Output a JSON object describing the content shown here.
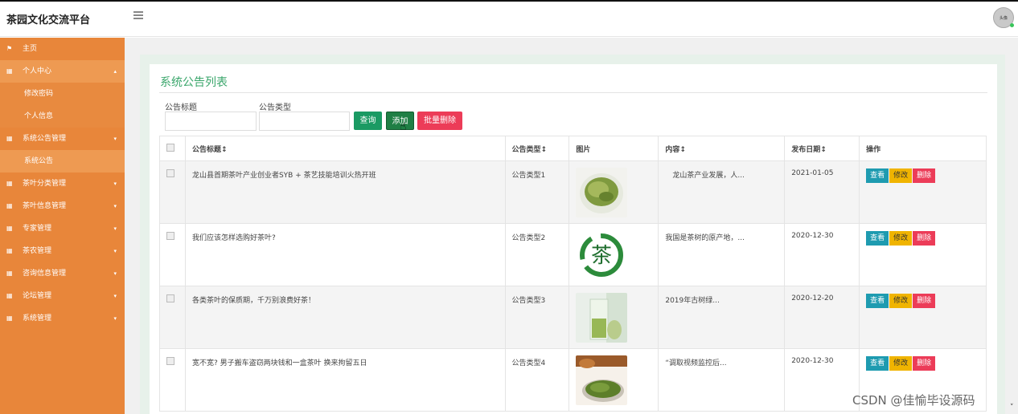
{
  "app": {
    "title": "茶园文化交流平台",
    "avatar_text": "头像"
  },
  "sidebar": {
    "items": [
      {
        "label": "主页",
        "icon": "flag-icon",
        "has_arrow": false
      },
      {
        "label": "个人中心",
        "icon": "grid-icon",
        "has_arrow": true,
        "active": true
      },
      {
        "label": "修改密码",
        "sub": true
      },
      {
        "label": "个人信息",
        "sub": true
      },
      {
        "label": "系统公告管理",
        "icon": "grid-icon",
        "has_arrow": true
      },
      {
        "label": "系统公告",
        "sub": true,
        "active": true
      },
      {
        "label": "茶叶分类管理",
        "icon": "grid-icon",
        "has_arrow": true
      },
      {
        "label": "茶叶信息管理",
        "icon": "grid-icon",
        "has_arrow": true
      },
      {
        "label": "专家管理",
        "icon": "grid-icon",
        "has_arrow": true
      },
      {
        "label": "茶农管理",
        "icon": "grid-icon",
        "has_arrow": true
      },
      {
        "label": "咨询信息管理",
        "icon": "grid-icon",
        "has_arrow": true
      },
      {
        "label": "论坛管理",
        "icon": "grid-icon",
        "has_arrow": true
      },
      {
        "label": "系统管理",
        "icon": "grid-icon",
        "has_arrow": true
      }
    ]
  },
  "main": {
    "title": "系统公告列表",
    "filters": {
      "title_label": "公告标题",
      "title_value": "",
      "type_label": "公告类型",
      "type_value": ""
    },
    "buttons": {
      "query": "查询",
      "add": "添加",
      "batch_delete": "批量删除"
    },
    "table": {
      "headers": [
        "公告标题↕",
        "公告类型↕",
        "图片",
        "内容↕",
        "发布日期↕",
        "操作"
      ],
      "rows": [
        {
          "title": "龙山县首期茶叶产业创业者SYB + 茶艺技能培训火热开班",
          "type": "公告类型1",
          "image": "green-tea-leaves",
          "content": "　龙山茶产业发展，人...",
          "date": "2021-01-05"
        },
        {
          "title": "我们应该怎样选购好茶叶?",
          "type": "公告类型2",
          "image": "tea-calligraphy-logo",
          "content": "我国是茶树的原产地，...",
          "date": "2020-12-30"
        },
        {
          "title": "各类茶叶的保质期，千万别浪费好茶！",
          "type": "公告类型3",
          "image": "tea-glass",
          "content": "2019年古树绿...",
          "date": "2020-12-20"
        },
        {
          "title": "宽不宽? 男子搬车盗窃两块钱和一盒茶叶 换来拘留五日",
          "type": "公告类型4",
          "image": "tea-cup",
          "content": "“调取视频监控后...",
          "date": "2020-12-30"
        }
      ],
      "ops": {
        "view": "查看",
        "edit": "修改",
        "delete": "删除"
      }
    }
  },
  "watermark": "CSDN @佳愉毕设源码",
  "scroll_marker": "˅",
  "colors": {
    "sidebar": "#e8863a",
    "accent_green": "#3aa66b",
    "view": "#1e9bb0",
    "edit": "#f0b400",
    "delete": "#ec3c58"
  }
}
